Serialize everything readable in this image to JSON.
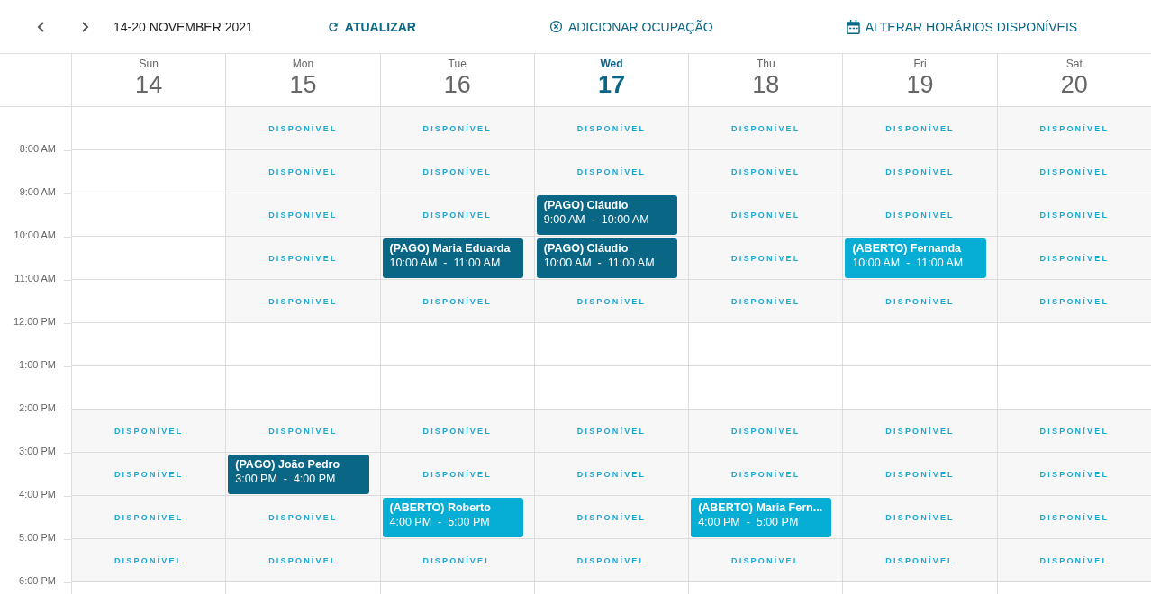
{
  "toolbar": {
    "range_label": "14-20 NOVEMBER 2021",
    "actions": [
      {
        "kind": "refresh",
        "label": "ATUALIZAR",
        "primary": true
      },
      {
        "kind": "add",
        "label": "ADICIONAR OCUPAÇÃO",
        "primary": false
      },
      {
        "kind": "calendar",
        "label": "ALTERAR HORÁRIOS DISPONÍVEIS",
        "primary": false
      }
    ]
  },
  "days": [
    {
      "weekday": "Sun",
      "date": "14",
      "selected": false
    },
    {
      "weekday": "Mon",
      "date": "15",
      "selected": false
    },
    {
      "weekday": "Tue",
      "date": "16",
      "selected": false
    },
    {
      "weekday": "Wed",
      "date": "17",
      "selected": true
    },
    {
      "weekday": "Thu",
      "date": "18",
      "selected": false
    },
    {
      "weekday": "Fri",
      "date": "19",
      "selected": false
    },
    {
      "weekday": "Sat",
      "date": "20",
      "selected": false
    }
  ],
  "rows": [
    {
      "cells": [
        {
          "kind": "empty"
        },
        {
          "kind": "available",
          "label": "DISPONÍVEL"
        },
        {
          "kind": "available",
          "label": "DISPONÍVEL"
        },
        {
          "kind": "available",
          "label": "DISPONÍVEL"
        },
        {
          "kind": "available",
          "label": "DISPONÍVEL"
        },
        {
          "kind": "available",
          "label": "DISPONÍVEL"
        },
        {
          "kind": "available",
          "label": "DISPONÍVEL"
        }
      ]
    },
    {
      "time": "8:00 AM",
      "cells": [
        {
          "kind": "empty"
        },
        {
          "kind": "available",
          "label": "DISPONÍVEL"
        },
        {
          "kind": "available",
          "label": "DISPONÍVEL"
        },
        {
          "kind": "available",
          "label": "DISPONÍVEL"
        },
        {
          "kind": "available",
          "label": "DISPONÍVEL"
        },
        {
          "kind": "available",
          "label": "DISPONÍVEL"
        },
        {
          "kind": "available",
          "label": "DISPONÍVEL"
        }
      ]
    },
    {
      "time": "9:00 AM",
      "cells": [
        {
          "kind": "empty"
        },
        {
          "kind": "available",
          "label": "DISPONÍVEL"
        },
        {
          "kind": "available",
          "label": "DISPONÍVEL"
        },
        {
          "kind": "event",
          "title": "(PAGO) Cláudio",
          "time": "9:00 AM  -  10:00 AM",
          "color": "#0a6685"
        },
        {
          "kind": "available",
          "label": "DISPONÍVEL"
        },
        {
          "kind": "available",
          "label": "DISPONÍVEL"
        },
        {
          "kind": "available",
          "label": "DISPONÍVEL"
        }
      ]
    },
    {
      "time": "10:00 AM",
      "cells": [
        {
          "kind": "empty"
        },
        {
          "kind": "available",
          "label": "DISPONÍVEL"
        },
        {
          "kind": "event",
          "title": "(PAGO) Maria Eduarda",
          "time": "10:00 AM  -  11:00 AM",
          "color": "#0a6685"
        },
        {
          "kind": "event",
          "title": "(PAGO) Cláudio",
          "time": "10:00 AM  -  11:00 AM",
          "color": "#0a6685"
        },
        {
          "kind": "available",
          "label": "DISPONÍVEL"
        },
        {
          "kind": "event",
          "title": "(ABERTO) Fernanda",
          "time": "10:00 AM  -  11:00 AM",
          "color": "#06aed5"
        },
        {
          "kind": "available",
          "label": "DISPONÍVEL"
        }
      ]
    },
    {
      "time": "11:00 AM",
      "cells": [
        {
          "kind": "empty"
        },
        {
          "kind": "available",
          "label": "DISPONÍVEL"
        },
        {
          "kind": "available",
          "label": "DISPONÍVEL"
        },
        {
          "kind": "available",
          "label": "DISPONÍVEL"
        },
        {
          "kind": "available",
          "label": "DISPONÍVEL"
        },
        {
          "kind": "available",
          "label": "DISPONÍVEL"
        },
        {
          "kind": "available",
          "label": "DISPONÍVEL"
        }
      ]
    },
    {
      "time": "12:00 PM",
      "cells": [
        {
          "kind": "empty"
        },
        {
          "kind": "empty"
        },
        {
          "kind": "empty"
        },
        {
          "kind": "empty"
        },
        {
          "kind": "empty"
        },
        {
          "kind": "empty"
        },
        {
          "kind": "empty"
        }
      ]
    },
    {
      "time": "1:00 PM",
      "cells": [
        {
          "kind": "empty"
        },
        {
          "kind": "empty"
        },
        {
          "kind": "empty"
        },
        {
          "kind": "empty"
        },
        {
          "kind": "empty"
        },
        {
          "kind": "empty"
        },
        {
          "kind": "empty"
        }
      ]
    },
    {
      "time": "2:00 PM",
      "cells": [
        {
          "kind": "available",
          "label": "DISPONÍVEL"
        },
        {
          "kind": "available",
          "label": "DISPONÍVEL"
        },
        {
          "kind": "available",
          "label": "DISPONÍVEL"
        },
        {
          "kind": "available",
          "label": "DISPONÍVEL"
        },
        {
          "kind": "available",
          "label": "DISPONÍVEL"
        },
        {
          "kind": "available",
          "label": "DISPONÍVEL"
        },
        {
          "kind": "available",
          "label": "DISPONÍVEL"
        }
      ]
    },
    {
      "time": "3:00 PM",
      "cells": [
        {
          "kind": "available",
          "label": "DISPONÍVEL"
        },
        {
          "kind": "event",
          "title": "(PAGO) João Pedro",
          "time": "3:00 PM  -  4:00 PM",
          "color": "#0a6685"
        },
        {
          "kind": "available",
          "label": "DISPONÍVEL"
        },
        {
          "kind": "available",
          "label": "DISPONÍVEL"
        },
        {
          "kind": "available",
          "label": "DISPONÍVEL"
        },
        {
          "kind": "available",
          "label": "DISPONÍVEL"
        },
        {
          "kind": "available",
          "label": "DISPONÍVEL"
        }
      ]
    },
    {
      "time": "4:00 PM",
      "cells": [
        {
          "kind": "available",
          "label": "DISPONÍVEL"
        },
        {
          "kind": "available",
          "label": "DISPONÍVEL"
        },
        {
          "kind": "event",
          "title": "(ABERTO) Roberto",
          "time": "4:00 PM  -  5:00 PM",
          "color": "#06aed5"
        },
        {
          "kind": "available",
          "label": "DISPONÍVEL"
        },
        {
          "kind": "event",
          "title": "(ABERTO) Maria Fern...",
          "time": "4:00 PM  -  5:00 PM",
          "color": "#06aed5"
        },
        {
          "kind": "available",
          "label": "DISPONÍVEL"
        },
        {
          "kind": "available",
          "label": "DISPONÍVEL"
        }
      ]
    },
    {
      "time": "5:00 PM",
      "cells": [
        {
          "kind": "available",
          "label": "DISPONÍVEL"
        },
        {
          "kind": "available",
          "label": "DISPONÍVEL"
        },
        {
          "kind": "available",
          "label": "DISPONÍVEL"
        },
        {
          "kind": "available",
          "label": "DISPONÍVEL"
        },
        {
          "kind": "available",
          "label": "DISPONÍVEL"
        },
        {
          "kind": "available",
          "label": "DISPONÍVEL"
        },
        {
          "kind": "available",
          "label": "DISPONÍVEL"
        }
      ]
    },
    {
      "time": "6:00 PM",
      "cells": [
        {
          "kind": "empty"
        },
        {
          "kind": "empty"
        },
        {
          "kind": "empty"
        },
        {
          "kind": "empty"
        },
        {
          "kind": "empty"
        },
        {
          "kind": "empty"
        },
        {
          "kind": "empty"
        }
      ]
    }
  ]
}
